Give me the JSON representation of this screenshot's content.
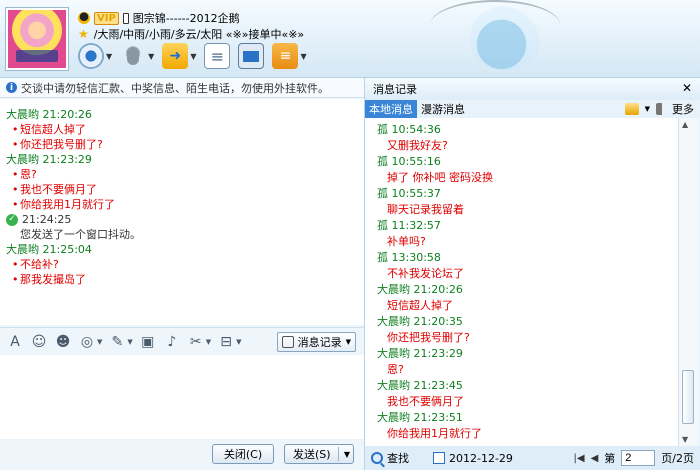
{
  "header": {
    "vip_label": "VIP",
    "name_line": "图宗锦------2012企鹅",
    "signature": "/大雨/中雨/小雨/多云/太阳 «※»接单中«※»"
  },
  "notice": "交谈中请勿轻信汇款、中奖信息、陌生电话，勿使用外挂软件。",
  "chat": {
    "blocks": [
      {
        "who": "大晨哟   21:20:26"
      },
      {
        "msg": "短信超人掉了"
      },
      {
        "msg": "你还把我号删了?"
      },
      {
        "who": "大晨哟   21:23:29"
      },
      {
        "msg": "恩?"
      },
      {
        "msg": "我也不要俩月了"
      },
      {
        "msg": "你给我用1月就行了"
      },
      {
        "systime": "21:24:25"
      },
      {
        "sys": "您发送了一个窗口抖动。"
      },
      {
        "who": "大晨哟   21:25:04"
      },
      {
        "msg": "不给补?"
      },
      {
        "msg": "那我发撮岛了"
      }
    ]
  },
  "format_bar": {
    "history_button": "消息记录"
  },
  "buttons": {
    "close": "关闭(C)",
    "send": "发送(S)"
  },
  "history": {
    "title": "消息记录",
    "tabs": [
      "本地消息",
      "漫游消息"
    ],
    "more": "更多",
    "items": [
      {
        "who": "孤    10:54:36"
      },
      {
        "msg": "又删我好友?"
      },
      {
        "who": "孤    10:55:16"
      },
      {
        "msg": "掉了  你补吧  密码没换"
      },
      {
        "who": "孤    10:55:37"
      },
      {
        "msg": "聊天记录我留着"
      },
      {
        "who": "孤    11:32:57"
      },
      {
        "msg": "补单吗?"
      },
      {
        "who": "孤    13:30:58"
      },
      {
        "msg": "不补我发论坛了"
      },
      {
        "who": "大晨哟  21:20:26"
      },
      {
        "msg": "短信超人掉了"
      },
      {
        "who": "大晨哟  21:20:35"
      },
      {
        "msg": "你还把我号删了?"
      },
      {
        "who": "大晨哟  21:23:29"
      },
      {
        "msg": "恩?"
      },
      {
        "who": "大晨哟  21:23:45"
      },
      {
        "msg": "我也不要俩月了"
      },
      {
        "who": "大晨哟  21:23:51"
      },
      {
        "msg": "你给我用1月就行了"
      }
    ],
    "footer": {
      "search_label": "查找",
      "date": "2012-12-29",
      "page_prefix": "第",
      "page_value": "2",
      "page_suffix": "页/2页"
    }
  }
}
